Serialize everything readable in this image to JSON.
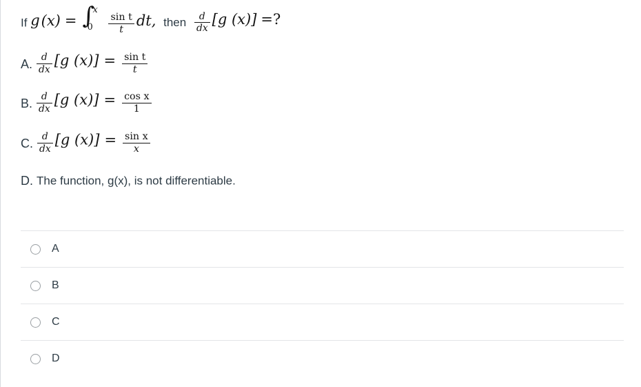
{
  "question": {
    "prefix": "If",
    "function_name": "g",
    "function_arg": "(x)",
    "equals": "=",
    "integral": {
      "lower_limit": "0",
      "upper_limit": "x",
      "numerator": "sin t",
      "denominator": "t",
      "differential": "dt,"
    },
    "then_word": "then",
    "derivative": {
      "numerator": "d",
      "denominator": "dx"
    },
    "bracketed": "[g (x)]",
    "tail": "=?"
  },
  "options": [
    {
      "letter": "A.",
      "kind": "math",
      "derivative": {
        "numerator": "d",
        "denominator": "dx"
      },
      "bracketed": "[g (x)]",
      "equals": "=",
      "result": {
        "numerator": "sin t",
        "denominator": "t"
      }
    },
    {
      "letter": "B.",
      "kind": "math",
      "derivative": {
        "numerator": "d",
        "denominator": "dx"
      },
      "bracketed": "[g (x)]",
      "equals": "=",
      "result": {
        "numerator": "cos x",
        "denominator": "1"
      }
    },
    {
      "letter": "C.",
      "kind": "math",
      "derivative": {
        "numerator": "d",
        "denominator": "dx"
      },
      "bracketed": "[g (x)]",
      "equals": "=",
      "result": {
        "numerator": "sin x",
        "denominator": "x"
      }
    },
    {
      "letter": "D.",
      "kind": "text",
      "text": "The function, g(x), is not differentiable."
    }
  ],
  "answer_choices": [
    {
      "label": "A",
      "selected": false
    },
    {
      "label": "B",
      "selected": false
    },
    {
      "label": "C",
      "selected": false
    },
    {
      "label": "D",
      "selected": false
    }
  ],
  "colors": {
    "text": "#2d3b45",
    "math": "#141414",
    "divider": "#e3e5e7",
    "radio_border": "#9a9fa3",
    "page_border": "#d7dade",
    "background": "#ffffff"
  }
}
